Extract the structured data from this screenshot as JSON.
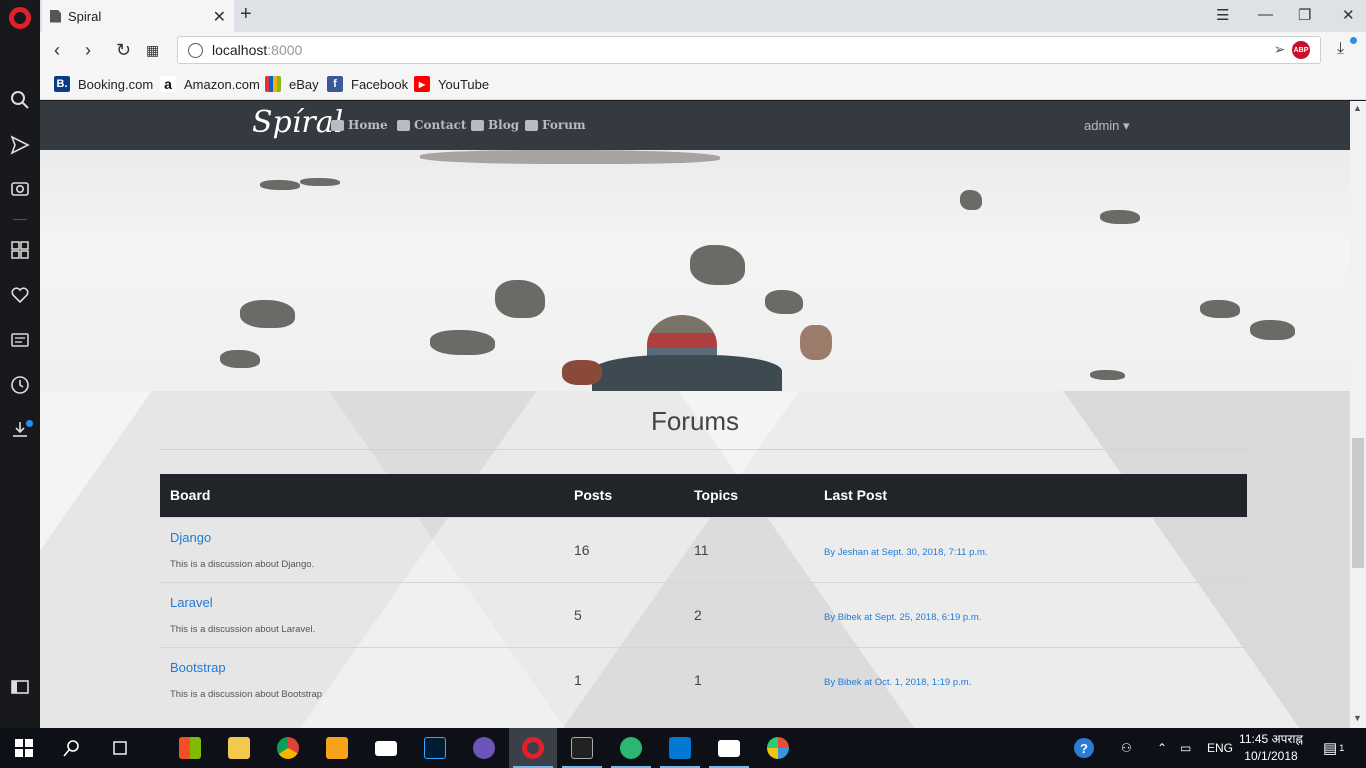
{
  "browser": {
    "tab_title": "Spiral",
    "tab_close": "✕",
    "new_tab": "+",
    "url_host": "localhost",
    "url_port": ":8000",
    "abp_label": "ABP",
    "bookmarks": [
      {
        "label": "Booking.com",
        "icon": "B.",
        "color": "#0b3b82"
      },
      {
        "label": "Amazon.com",
        "icon": "a",
        "color": "#111111"
      },
      {
        "label": "eBay",
        "icon": "",
        "color": "#e53238"
      },
      {
        "label": "Facebook",
        "icon": "f",
        "color": "#3b5998"
      },
      {
        "label": "YouTube",
        "icon": "▶",
        "color": "#ff0000"
      }
    ]
  },
  "site": {
    "brand": "Spíral",
    "nav": [
      {
        "label": "Home"
      },
      {
        "label": "Contact"
      },
      {
        "label": "Blog"
      },
      {
        "label": "Forum"
      }
    ],
    "user_menu": "admin ▾"
  },
  "page": {
    "title": "Forums",
    "table": {
      "headers": [
        "Board",
        "Posts",
        "Topics",
        "Last Post"
      ],
      "rows": [
        {
          "board": "Django",
          "desc": "This is a discussion about Django.",
          "posts": "16",
          "topics": "11",
          "last_post": "By Jeshan at Sept. 30, 2018, 7:11 p.m."
        },
        {
          "board": "Laravel",
          "desc": "This is a discussion about Laravel.",
          "posts": "5",
          "topics": "2",
          "last_post": "By Bibek at Sept. 25, 2018, 6:19 p.m."
        },
        {
          "board": "Bootstrap",
          "desc": "This is a discussion about Bootstrap",
          "posts": "1",
          "topics": "1",
          "last_post": "By Bibek at Oct. 1, 2018, 1:19 p.m."
        }
      ]
    }
  },
  "taskbar": {
    "language": "ENG",
    "time": "11:45 अपराह्न",
    "date": "10/1/2018",
    "notification_count": "1"
  },
  "colors": {
    "accent": "#1e7ad8",
    "navbar": "#343a40",
    "table_header": "#212529",
    "opera_red": "#e0202a"
  }
}
